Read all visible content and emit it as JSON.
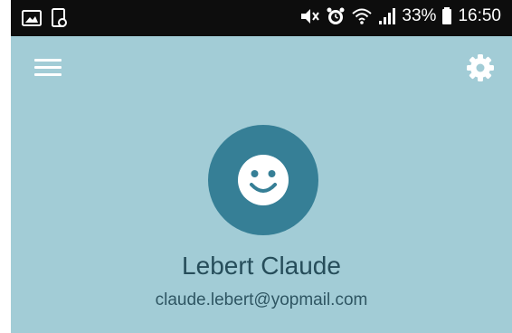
{
  "status_bar": {
    "battery_percent": "33%",
    "time": "16:50",
    "icons": [
      "image-icon",
      "screenshot-icon",
      "mute-icon",
      "alarm-icon",
      "wifi-icon",
      "signal-icon",
      "battery-icon"
    ]
  },
  "toolbar": {
    "menu_icon": "hamburger-menu-icon",
    "settings_icon": "gear-icon"
  },
  "profile": {
    "avatar_icon": "smiley-face-icon",
    "name": "Lebert Claude",
    "email": "claude.lebert@yopmail.com"
  },
  "colors": {
    "status_bar_bg": "#0d0d0d",
    "screen_bg": "#a2ccd6",
    "avatar_bg": "#367f96",
    "name_text": "#264d5a"
  }
}
